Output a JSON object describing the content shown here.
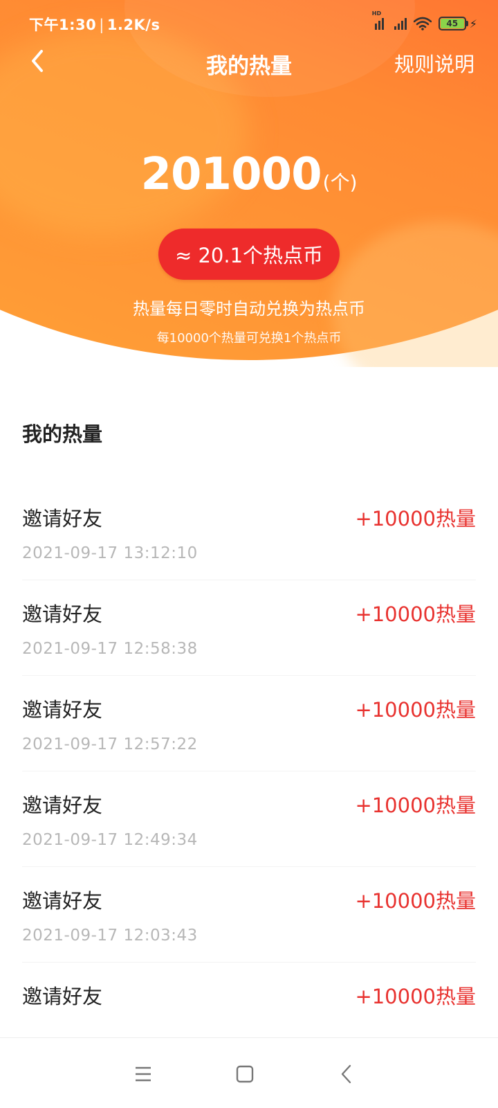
{
  "status_bar": {
    "time": "下午1:30",
    "speed": "1.2K/s",
    "network_badge": "HD",
    "battery_level": "45",
    "icons": [
      "signal-icon",
      "signal-icon",
      "wifi-icon",
      "battery-icon",
      "charging-icon"
    ]
  },
  "nav": {
    "title": "我的热量",
    "rules_label": "规则说明"
  },
  "summary": {
    "amount": "201000",
    "unit": "(个)",
    "coin_equivalent": "≈ 20.1个热点币",
    "info_line1": "热量每日零时自动兑换为热点币",
    "info_line2": "每10000个热量可兑换1个热点币"
  },
  "list": {
    "section_title": "我的热量",
    "records": [
      {
        "title": "邀请好友",
        "amount": "+10000热量",
        "time": "2021-09-17 13:12:10"
      },
      {
        "title": "邀请好友",
        "amount": "+10000热量",
        "time": "2021-09-17 12:58:38"
      },
      {
        "title": "邀请好友",
        "amount": "+10000热量",
        "time": "2021-09-17 12:57:22"
      },
      {
        "title": "邀请好友",
        "amount": "+10000热量",
        "time": "2021-09-17 12:49:34"
      },
      {
        "title": "邀请好友",
        "amount": "+10000热量",
        "time": "2021-09-17 12:03:43"
      },
      {
        "title": "邀请好友",
        "amount": "+10000热量",
        "time": ""
      }
    ]
  },
  "colors": {
    "header_start": "#ff3f2c",
    "header_end": "#ffa438",
    "pill": "#ee2b2b",
    "amount_text": "#e8322f",
    "time_text": "#b7b7b7"
  },
  "system_nav": {
    "icons": [
      "menu-icon",
      "home-icon",
      "back-icon"
    ]
  }
}
